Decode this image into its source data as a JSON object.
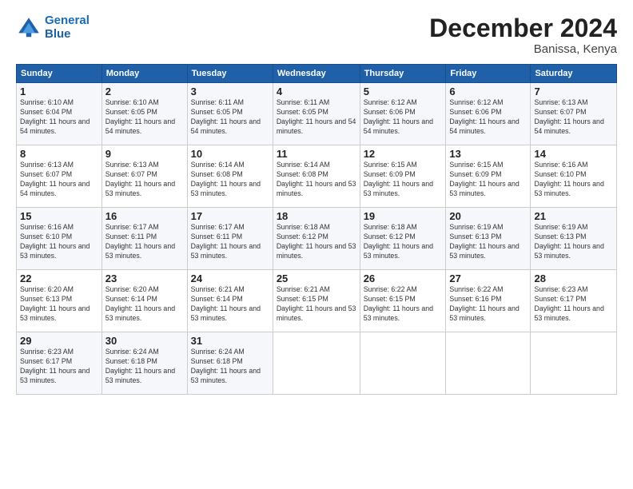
{
  "logo": {
    "line1": "General",
    "line2": "Blue"
  },
  "title": "December 2024",
  "subtitle": "Banissa, Kenya",
  "days_header": [
    "Sunday",
    "Monday",
    "Tuesday",
    "Wednesday",
    "Thursday",
    "Friday",
    "Saturday"
  ],
  "weeks": [
    [
      {
        "day": "1",
        "sunrise": "6:10 AM",
        "sunset": "6:04 PM",
        "daylight": "11 hours and 54 minutes."
      },
      {
        "day": "2",
        "sunrise": "6:10 AM",
        "sunset": "6:05 PM",
        "daylight": "11 hours and 54 minutes."
      },
      {
        "day": "3",
        "sunrise": "6:11 AM",
        "sunset": "6:05 PM",
        "daylight": "11 hours and 54 minutes."
      },
      {
        "day": "4",
        "sunrise": "6:11 AM",
        "sunset": "6:05 PM",
        "daylight": "11 hours and 54 minutes."
      },
      {
        "day": "5",
        "sunrise": "6:12 AM",
        "sunset": "6:06 PM",
        "daylight": "11 hours and 54 minutes."
      },
      {
        "day": "6",
        "sunrise": "6:12 AM",
        "sunset": "6:06 PM",
        "daylight": "11 hours and 54 minutes."
      },
      {
        "day": "7",
        "sunrise": "6:13 AM",
        "sunset": "6:07 PM",
        "daylight": "11 hours and 54 minutes."
      }
    ],
    [
      {
        "day": "8",
        "sunrise": "6:13 AM",
        "sunset": "6:07 PM",
        "daylight": "11 hours and 54 minutes."
      },
      {
        "day": "9",
        "sunrise": "6:13 AM",
        "sunset": "6:07 PM",
        "daylight": "11 hours and 53 minutes."
      },
      {
        "day": "10",
        "sunrise": "6:14 AM",
        "sunset": "6:08 PM",
        "daylight": "11 hours and 53 minutes."
      },
      {
        "day": "11",
        "sunrise": "6:14 AM",
        "sunset": "6:08 PM",
        "daylight": "11 hours and 53 minutes."
      },
      {
        "day": "12",
        "sunrise": "6:15 AM",
        "sunset": "6:09 PM",
        "daylight": "11 hours and 53 minutes."
      },
      {
        "day": "13",
        "sunrise": "6:15 AM",
        "sunset": "6:09 PM",
        "daylight": "11 hours and 53 minutes."
      },
      {
        "day": "14",
        "sunrise": "6:16 AM",
        "sunset": "6:10 PM",
        "daylight": "11 hours and 53 minutes."
      }
    ],
    [
      {
        "day": "15",
        "sunrise": "6:16 AM",
        "sunset": "6:10 PM",
        "daylight": "11 hours and 53 minutes."
      },
      {
        "day": "16",
        "sunrise": "6:17 AM",
        "sunset": "6:11 PM",
        "daylight": "11 hours and 53 minutes."
      },
      {
        "day": "17",
        "sunrise": "6:17 AM",
        "sunset": "6:11 PM",
        "daylight": "11 hours and 53 minutes."
      },
      {
        "day": "18",
        "sunrise": "6:18 AM",
        "sunset": "6:12 PM",
        "daylight": "11 hours and 53 minutes."
      },
      {
        "day": "19",
        "sunrise": "6:18 AM",
        "sunset": "6:12 PM",
        "daylight": "11 hours and 53 minutes."
      },
      {
        "day": "20",
        "sunrise": "6:19 AM",
        "sunset": "6:13 PM",
        "daylight": "11 hours and 53 minutes."
      },
      {
        "day": "21",
        "sunrise": "6:19 AM",
        "sunset": "6:13 PM",
        "daylight": "11 hours and 53 minutes."
      }
    ],
    [
      {
        "day": "22",
        "sunrise": "6:20 AM",
        "sunset": "6:13 PM",
        "daylight": "11 hours and 53 minutes."
      },
      {
        "day": "23",
        "sunrise": "6:20 AM",
        "sunset": "6:14 PM",
        "daylight": "11 hours and 53 minutes."
      },
      {
        "day": "24",
        "sunrise": "6:21 AM",
        "sunset": "6:14 PM",
        "daylight": "11 hours and 53 minutes."
      },
      {
        "day": "25",
        "sunrise": "6:21 AM",
        "sunset": "6:15 PM",
        "daylight": "11 hours and 53 minutes."
      },
      {
        "day": "26",
        "sunrise": "6:22 AM",
        "sunset": "6:15 PM",
        "daylight": "11 hours and 53 minutes."
      },
      {
        "day": "27",
        "sunrise": "6:22 AM",
        "sunset": "6:16 PM",
        "daylight": "11 hours and 53 minutes."
      },
      {
        "day": "28",
        "sunrise": "6:23 AM",
        "sunset": "6:17 PM",
        "daylight": "11 hours and 53 minutes."
      }
    ],
    [
      {
        "day": "29",
        "sunrise": "6:23 AM",
        "sunset": "6:17 PM",
        "daylight": "11 hours and 53 minutes."
      },
      {
        "day": "30",
        "sunrise": "6:24 AM",
        "sunset": "6:18 PM",
        "daylight": "11 hours and 53 minutes."
      },
      {
        "day": "31",
        "sunrise": "6:24 AM",
        "sunset": "6:18 PM",
        "daylight": "11 hours and 53 minutes."
      },
      null,
      null,
      null,
      null
    ]
  ]
}
